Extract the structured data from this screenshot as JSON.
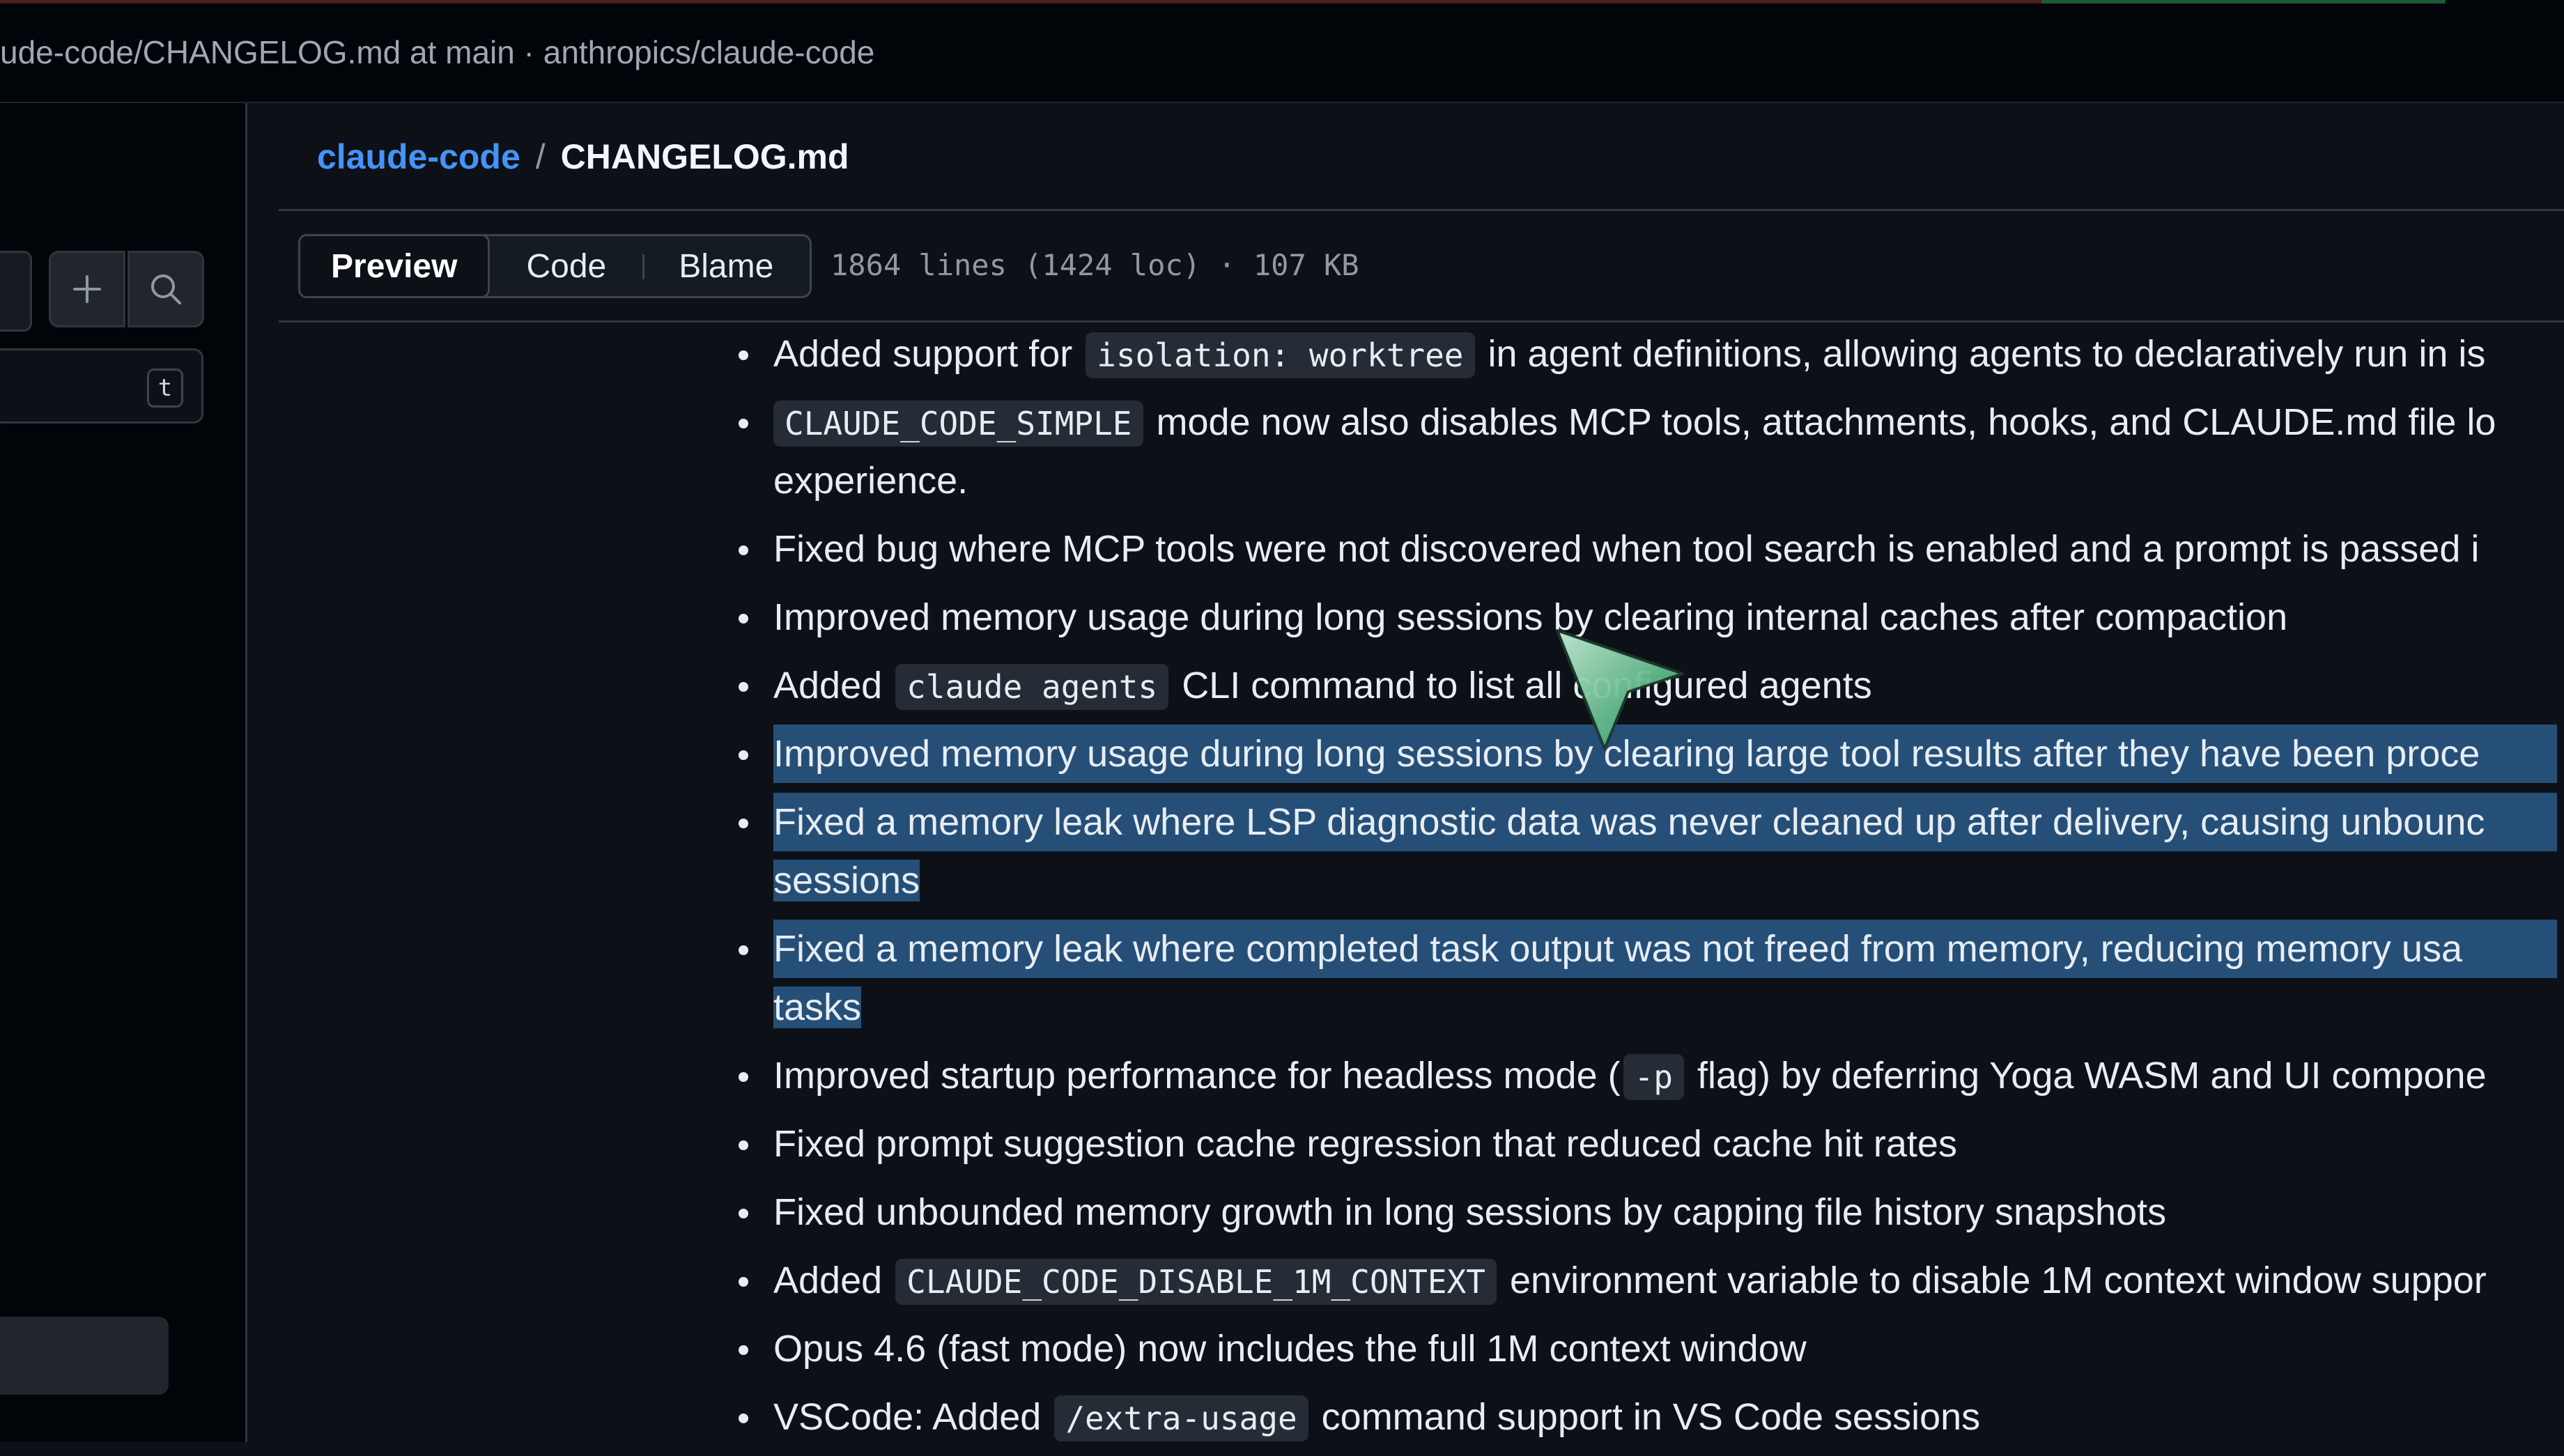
{
  "window": {
    "title": "ude-code/CHANGELOG.md at main · anthropics/claude-code"
  },
  "breadcrumb": {
    "repo": "claude-code",
    "separator": "/",
    "file": "CHANGELOG.md"
  },
  "sidebar": {
    "filter_shortcut": "t"
  },
  "view_tabs": {
    "preview": "Preview",
    "code": "Code",
    "blame": "Blame",
    "active": "Preview"
  },
  "file_meta": "1864 lines (1424 loc) · 107 KB",
  "changelog": {
    "item1": {
      "pre": "Added support for ",
      "code": "isolation: worktree",
      "post": " in agent definitions, allowing agents to declaratively run in is"
    },
    "item2": {
      "code": "CLAUDE_CODE_SIMPLE",
      "post": " mode now also disables MCP tools, attachments, hooks, and CLAUDE.md file lo",
      "cont": "experience."
    },
    "item3": {
      "text": "Fixed bug where MCP tools were not discovered when tool search is enabled and a prompt is passed i"
    },
    "item4": {
      "text": "Improved memory usage during long sessions by clearing internal caches after compaction"
    },
    "item5": {
      "pre": "Added ",
      "code": "claude agents",
      "post": " CLI command to list all configured agents"
    },
    "item6": {
      "text": "Improved memory usage during long sessions by clearing large tool results after they have been proce"
    },
    "item7": {
      "line1": "Fixed a memory leak where LSP diagnostic data was never cleaned up after delivery, causing unbounc",
      "line2": "sessions"
    },
    "item8": {
      "line1": "Fixed a memory leak where completed task output was not freed from memory, reducing memory usa",
      "line2": "tasks"
    },
    "item9": {
      "pre": "Improved startup performance for headless mode (",
      "code": "-p",
      "post": " flag) by deferring Yoga WASM and UI compone"
    },
    "item10": {
      "text": "Fixed prompt suggestion cache regression that reduced cache hit rates"
    },
    "item11": {
      "text": "Fixed unbounded memory growth in long sessions by capping file history snapshots"
    },
    "item12": {
      "pre": "Added ",
      "code": "CLAUDE_CODE_DISABLE_1M_CONTEXT",
      "post": " environment variable to disable 1M context window suppor"
    },
    "item13": {
      "text": "Opus 4.6 (fast mode) now includes the full 1M context window"
    },
    "item14": {
      "pre": "VSCode: Added ",
      "code": "/extra-usage",
      "post": " command support in VS Code sessions"
    }
  },
  "colors": {
    "background": "#0d1117",
    "link": "#4493f8",
    "selection": "#264f78"
  }
}
